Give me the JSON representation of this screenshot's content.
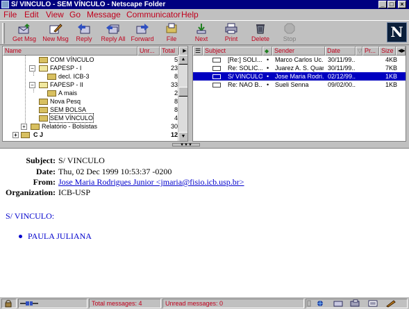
{
  "window": {
    "title": "S/ VINCULO - SEM VÍNCULO - Netscape Folder",
    "buttons": {
      "minimize": "_",
      "maximize": "□",
      "close": "×"
    }
  },
  "menu": [
    "File",
    "Edit",
    "View",
    "Go",
    "Message",
    "Communicator",
    "Help"
  ],
  "toolbar": {
    "buttons": [
      {
        "label": "Get Msg",
        "icon": "get-msg-icon"
      },
      {
        "label": "New Msg",
        "icon": "new-msg-icon"
      },
      {
        "label": "Reply",
        "icon": "reply-icon"
      },
      {
        "label": "Reply All",
        "icon": "reply-all-icon"
      },
      {
        "label": "Forward",
        "icon": "forward-icon"
      },
      {
        "label": "File",
        "icon": "file-icon"
      },
      {
        "label": "Next",
        "icon": "next-icon"
      },
      {
        "label": "Print",
        "icon": "print-icon"
      },
      {
        "label": "Delete",
        "icon": "delete-icon"
      },
      {
        "label": "Stop",
        "icon": "stop-icon",
        "disabled": true
      }
    ],
    "logo": "N"
  },
  "folder_pane": {
    "columns": {
      "name": "Name",
      "unread": "Unr...",
      "total": "Total"
    },
    "folders": [
      {
        "name": "COM VÍNCULO",
        "unread": "",
        "total": "5"
      },
      {
        "name": "FAPESP - I",
        "unread": "",
        "total": "23"
      },
      {
        "name": "decl. ICB-3",
        "unread": "",
        "total": "8"
      },
      {
        "name": "FAPESP - II",
        "unread": "",
        "total": "33"
      },
      {
        "name": "A mais",
        "unread": "",
        "total": "2"
      },
      {
        "name": "Nova Pesq",
        "unread": "",
        "total": "8"
      },
      {
        "name": "SEM BOLSA",
        "unread": "",
        "total": "8"
      },
      {
        "name": "SEM VÍNCULO",
        "unread": "",
        "total": "4",
        "selected": true
      },
      {
        "name": "Relatório - Bolsistas",
        "unread": "",
        "total": "30"
      },
      {
        "name": "C J",
        "unread": "",
        "total": "12",
        "bold": true
      }
    ]
  },
  "message_list": {
    "columns": {
      "subject": "Subject",
      "sender": "Sender",
      "date": "Date",
      "priority": "Pr...",
      "size": "Size"
    },
    "messages": [
      {
        "subject": "[Re:] SOLI...",
        "sender": "Marco Carlos Uc...",
        "date": "30/11/99...",
        "size": "4KB"
      },
      {
        "subject": "Re: SOLIC...",
        "sender": "Juarez A. S. Quar...",
        "date": "30/11/99...",
        "size": "7KB"
      },
      {
        "subject": "S/ VINCULO",
        "sender": "Jose Maria Rodri...",
        "date": "02/12/99...",
        "size": "1KB",
        "selected": true
      },
      {
        "subject": "Re: NAO B...",
        "sender": "Sueli Senna",
        "date": "09/02/00...",
        "size": "1KB"
      }
    ]
  },
  "message": {
    "labels": {
      "subject": "Subject:",
      "date": "Date:",
      "from": "From:",
      "organization": "Organization:"
    },
    "subject": "S/ VINCULO",
    "date": "Thu, 02 Dec 1999 10:53:37 -0200",
    "from": "Jose Maria Rodrigues Junior <jmaria@fisio.icb.usp.br>",
    "organization": "ICB-USP",
    "body_line": "S/ VINCULO:",
    "body_list": [
      "PAULA JULIANA"
    ]
  },
  "status": {
    "total": "Total messages: 4",
    "unread": "Unread messages: 0"
  },
  "colors": {
    "accent_red": "#c0001c",
    "selection": "#0000c0",
    "title_bar": "#000080",
    "link": "#0000cc"
  }
}
